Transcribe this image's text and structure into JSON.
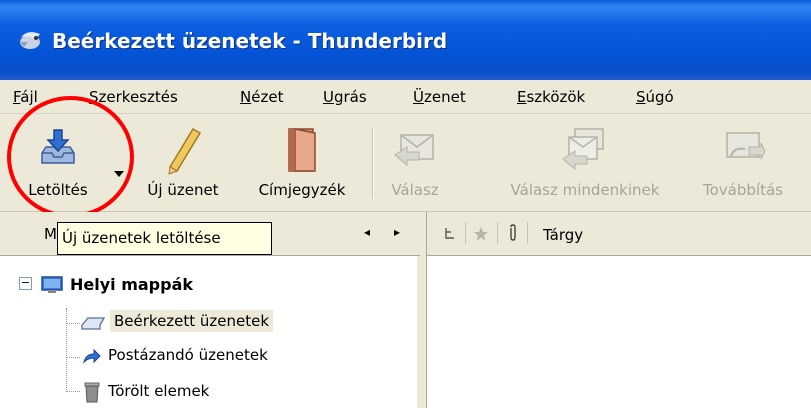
{
  "window": {
    "title": "Beérkezett üzenetek - Thunderbird"
  },
  "menubar": {
    "items": [
      {
        "pre": "",
        "acc": "F",
        "post": "ájl"
      },
      {
        "pre": "",
        "acc": "S",
        "post": "zerkesztés"
      },
      {
        "pre": "",
        "acc": "N",
        "post": "ézet"
      },
      {
        "pre": "",
        "acc": "U",
        "post": "grás"
      },
      {
        "pre": "",
        "acc": "Ü",
        "post": "zenet"
      },
      {
        "pre": "",
        "acc": "E",
        "post": "szközök"
      },
      {
        "pre": "",
        "acc": "S",
        "post": "úgó"
      }
    ]
  },
  "toolbar": {
    "get_mail": "Letöltés",
    "new_message": "Új üzenet",
    "address_book": "Címjegyzék",
    "reply": "Válasz",
    "reply_all": "Válasz mindenkinek",
    "forward": "Továbbítás"
  },
  "tooltip": {
    "text": "Új üzenetek letöltése"
  },
  "folder_pane": {
    "header_prefix": "M",
    "nav_prev": "◂",
    "nav_next": "▸",
    "expander": "−",
    "root": "Helyi mappák",
    "folders": [
      "Beérkezett üzenetek",
      "Postázandó üzenetek",
      "Törölt elemek"
    ]
  },
  "message_pane": {
    "subject_header": "Tárgy"
  },
  "colors": {
    "highlight_circle": "#ff0000",
    "title_bar": "#0453d6"
  }
}
